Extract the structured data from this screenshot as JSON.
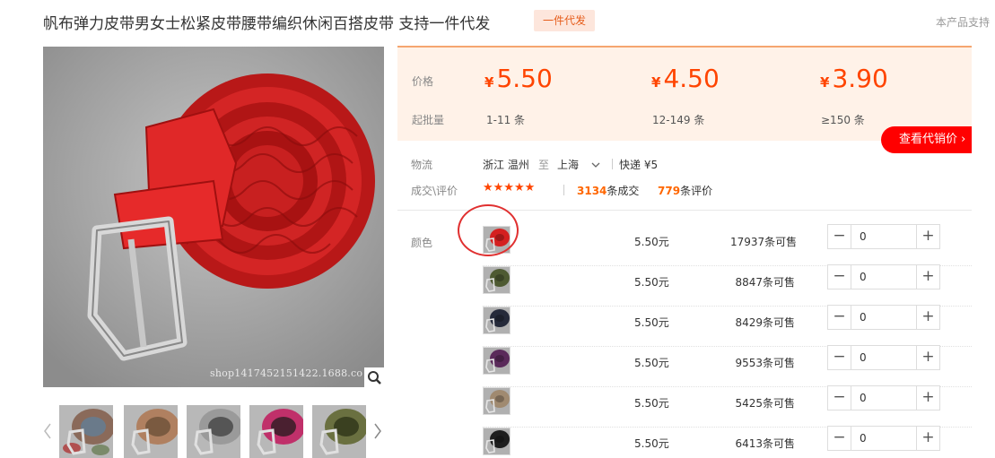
{
  "header": {
    "title": "帆布弹力皮带男女士松紧皮带腰带编织休闲百搭皮带 支持一件代发",
    "badge": "一件代发",
    "support_text": "本产品支持"
  },
  "gallery": {
    "watermark": "shop1417452151422.1688.co",
    "thumbnails": [
      {
        "name": "multicolor-belts",
        "colors": [
          "#8a6a5a",
          "#6a7a8a",
          "#b05050",
          "#7a8a6a"
        ]
      },
      {
        "name": "brown-belt",
        "colors": [
          "#b08060",
          "#7a5a40"
        ]
      },
      {
        "name": "gray-belt",
        "colors": [
          "#9a9a9a",
          "#555555"
        ]
      },
      {
        "name": "magenta-belt",
        "colors": [
          "#c0306a",
          "#4a2030"
        ]
      },
      {
        "name": "olive-belt",
        "colors": [
          "#6a7040",
          "#3a4020"
        ]
      }
    ]
  },
  "pricing": {
    "price_label": "价格",
    "moq_label": "起批量",
    "currency": "¥",
    "tiers": [
      {
        "price": "5.50",
        "range": "1-11 条"
      },
      {
        "price": "4.50",
        "range": "12-149 条"
      },
      {
        "price": "3.90",
        "range": "≥150 条"
      }
    ],
    "agent_button": "查看代销价 ›",
    "accent_color": "#ff4400"
  },
  "logistics": {
    "label": "物流",
    "origin": "浙江 温州",
    "to": "至",
    "destination": "上海",
    "shipping": "快递 ¥5"
  },
  "reviews": {
    "label": "成交\\评价",
    "stars": "★★★★★",
    "deals_count": "3134",
    "deals_suffix": "条成交",
    "review_count": "779",
    "review_suffix": "条评价"
  },
  "sku": {
    "label": "颜色",
    "rows": [
      {
        "color": "#d42020",
        "price": "5.50元",
        "stock": "17937条可售",
        "qty": "0"
      },
      {
        "color": "#4e5a32",
        "price": "5.50元",
        "stock": "8847条可售",
        "qty": "0"
      },
      {
        "color": "#252a3a",
        "price": "5.50元",
        "stock": "8429条可售",
        "qty": "0"
      },
      {
        "color": "#5a2a5a",
        "price": "5.50元",
        "stock": "9553条可售",
        "qty": "0"
      },
      {
        "color": "#a08a70",
        "price": "5.50元",
        "stock": "5425条可售",
        "qty": "0"
      },
      {
        "color": "#1e1e1e",
        "price": "5.50元",
        "stock": "6413条可售",
        "qty": "0"
      }
    ]
  }
}
